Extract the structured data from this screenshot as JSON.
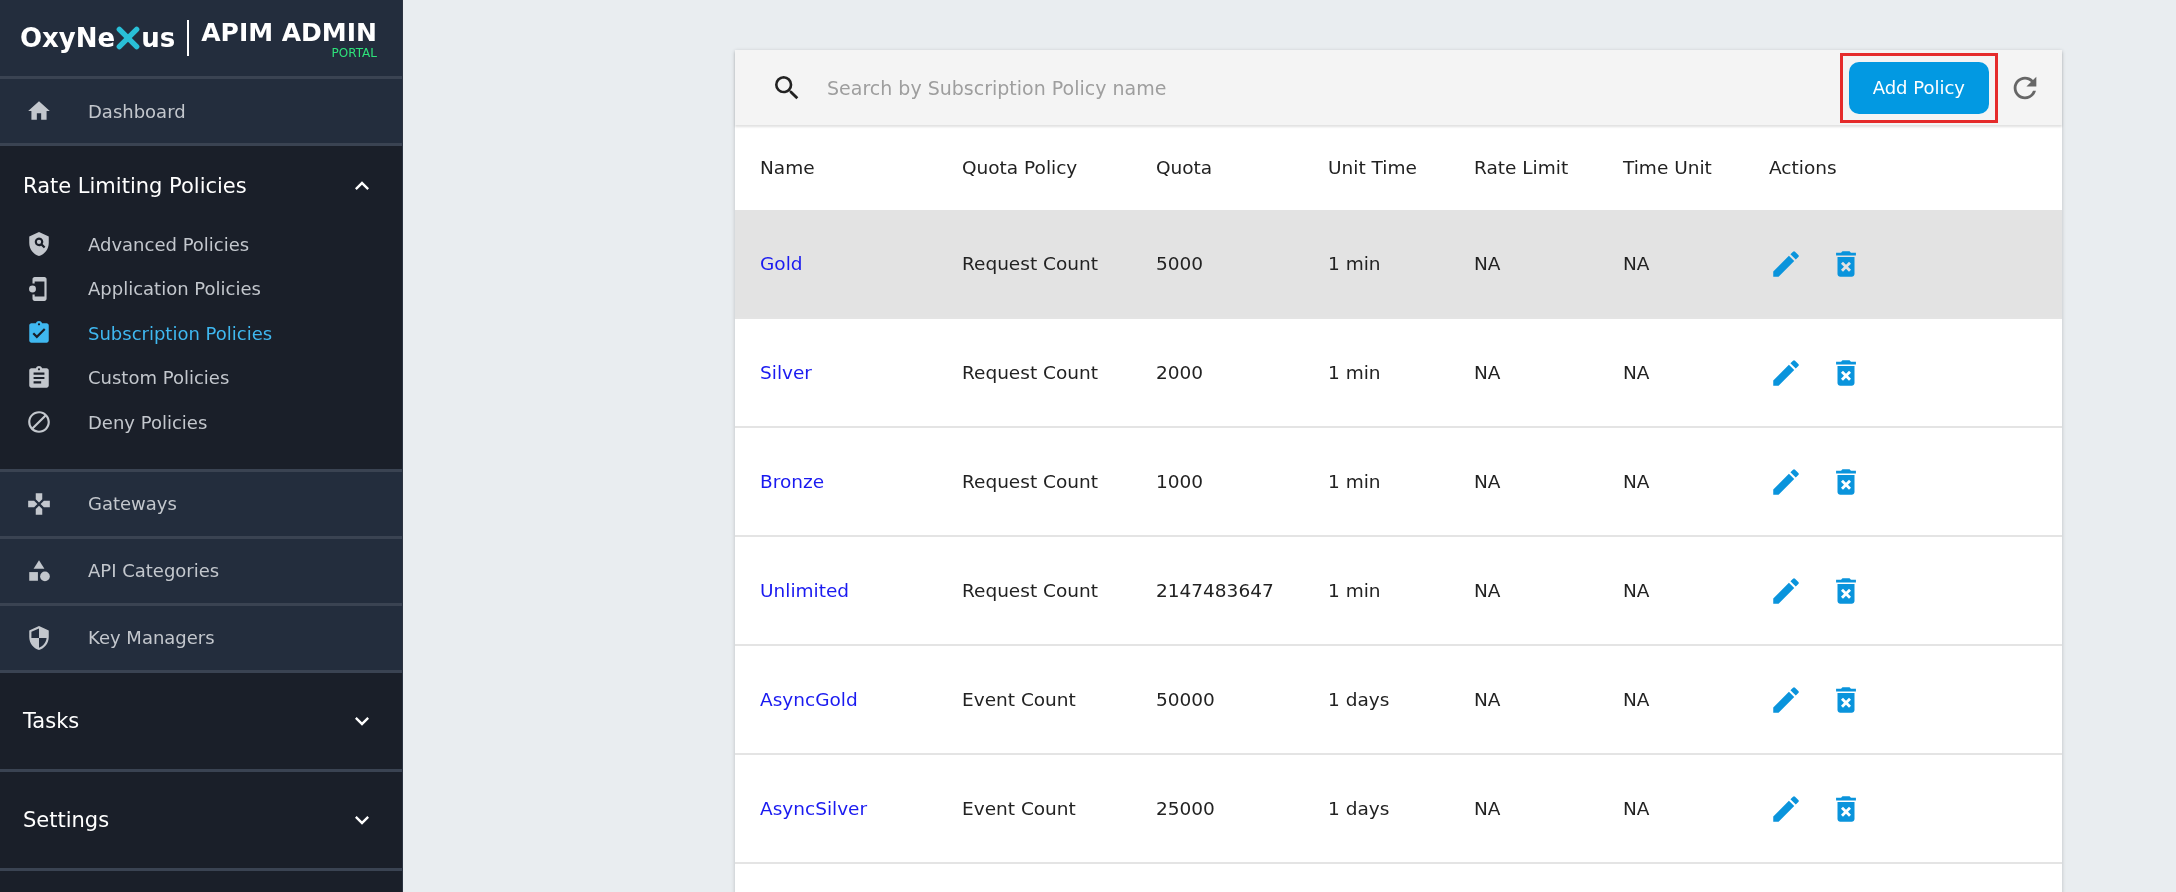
{
  "sidebar": {
    "logo": {
      "brand_start": "OxyNe",
      "brand_end": "us",
      "title": "APIM ADMIN",
      "subtitle": "PORTAL"
    },
    "items": [
      {
        "kind": "link",
        "label": "Dashboard"
      },
      {
        "kind": "group",
        "label": "Rate Limiting Policies",
        "expanded": true,
        "children": [
          {
            "label": "Advanced Policies",
            "selected": false
          },
          {
            "label": "Application Policies",
            "selected": false
          },
          {
            "label": "Subscription Policies",
            "selected": true
          },
          {
            "label": "Custom Policies",
            "selected": false
          },
          {
            "label": "Deny Policies",
            "selected": false
          }
        ]
      },
      {
        "kind": "link",
        "label": "Gateways"
      },
      {
        "kind": "link",
        "label": "API Categories"
      },
      {
        "kind": "link",
        "label": "Key Managers"
      },
      {
        "kind": "group",
        "label": "Tasks",
        "expanded": false
      },
      {
        "kind": "group",
        "label": "Settings",
        "expanded": false
      }
    ]
  },
  "toolbar": {
    "search": {
      "placeholder": "Search by Subscription Policy name"
    },
    "add_button": {
      "label": "Add Policy",
      "highlighted": true
    }
  },
  "table": {
    "columns": [
      "Name",
      "Quota Policy",
      "Quota",
      "Unit Time",
      "Rate Limit",
      "Time Unit",
      "Actions"
    ],
    "rows": [
      {
        "name": "Gold",
        "quota_policy": "Request Count",
        "quota": "5000",
        "unit_time": "1 min",
        "rate_limit": "NA",
        "time_unit": "NA",
        "highlighted": true
      },
      {
        "name": "Silver",
        "quota_policy": "Request Count",
        "quota": "2000",
        "unit_time": "1 min",
        "rate_limit": "NA",
        "time_unit": "NA",
        "highlighted": false
      },
      {
        "name": "Bronze",
        "quota_policy": "Request Count",
        "quota": "1000",
        "unit_time": "1 min",
        "rate_limit": "NA",
        "time_unit": "NA",
        "highlighted": false
      },
      {
        "name": "Unlimited",
        "quota_policy": "Request Count",
        "quota": "2147483647",
        "unit_time": "1 min",
        "rate_limit": "NA",
        "time_unit": "NA",
        "highlighted": false
      },
      {
        "name": "AsyncGold",
        "quota_policy": "Event Count",
        "quota": "50000",
        "unit_time": "1 days",
        "rate_limit": "NA",
        "time_unit": "NA",
        "highlighted": false
      },
      {
        "name": "AsyncSilver",
        "quota_policy": "Event Count",
        "quota": "25000",
        "unit_time": "1 days",
        "rate_limit": "NA",
        "time_unit": "NA",
        "highlighted": false
      }
    ]
  }
}
